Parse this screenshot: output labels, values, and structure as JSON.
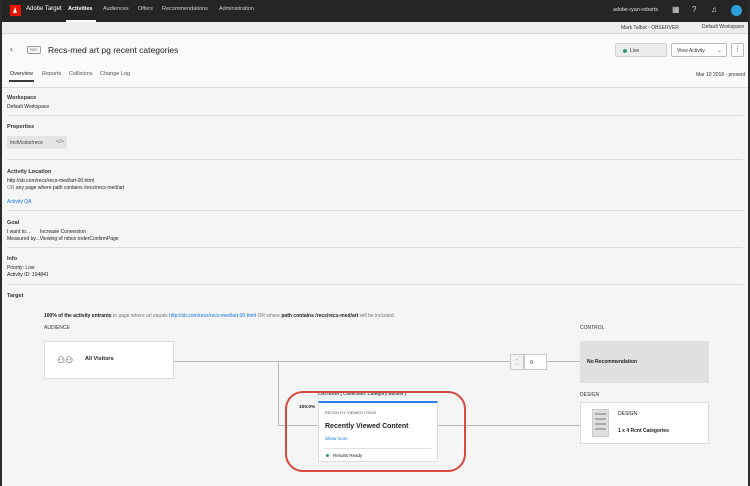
{
  "topnav": {
    "app_name": "Adobe Target",
    "items": [
      "Activities",
      "Audiences",
      "Offers",
      "Recommendations",
      "Administration"
    ],
    "user": "adobe-ryan-roberts"
  },
  "subbar": {
    "observer": "Mark Talbot - OBSERVER",
    "workspace": "Default Workspace"
  },
  "header": {
    "badge": "REC",
    "title": "Recs-med art pg recent categories",
    "status": "Live",
    "view_activity": "View Activity",
    "tabs": [
      "Overview",
      "Reports",
      "Collisions",
      "Change Log"
    ],
    "date_range": "Mar 10 2018 - present"
  },
  "overview": {
    "workspace": {
      "title": "Workspace",
      "value": "Default Workspace"
    },
    "properties": {
      "title": "Properties",
      "value": "Inch/color/recs"
    },
    "location": {
      "title": "Activity Location",
      "url": "http://sb.com/recs/recs-med/art-00.html",
      "or_word": "OR",
      "or_rest": "any page where path contains /recs/recs-med/art",
      "qa_link": "Activity QA"
    },
    "goal": {
      "title": "Goal",
      "want_label": "I want to...",
      "want_value": "Increase Conversion",
      "measured": "Measured by...Viewing of mbox orderConfirmPage"
    },
    "info": {
      "title": "Info",
      "priority": "Priority: Low",
      "activity_id": "Activity ID: 194841"
    },
    "target": {
      "title": "Target",
      "entrants_bold": "100% of the activity entrants",
      "entrants_rest": "to page where url equals",
      "url": "http://sb.com/recs/recs-med/art-00.html",
      "or_where": "OR where",
      "path_bold": "path contains /recs/recs-med/art",
      "tail": "will be included."
    }
  },
  "flow": {
    "audience_label": "AUDIENCE",
    "audience_name": "All Visitors",
    "control_label": "CONTROL",
    "split_value": "0",
    "control_card": "No Recommendation",
    "design_label": "DESIGN",
    "design_title": "DESIGN",
    "design_name": "1 x 4 Rcnt Categories",
    "criteria_tab": "CRITERIA ( Collection: Category Bucket )",
    "percent": "100.0%",
    "criteria_kicker": "RECENTLY VIEWED ITEMS",
    "criteria_title": "Recently Viewed Content",
    "show_more": "Show more",
    "results": "Results Ready"
  }
}
